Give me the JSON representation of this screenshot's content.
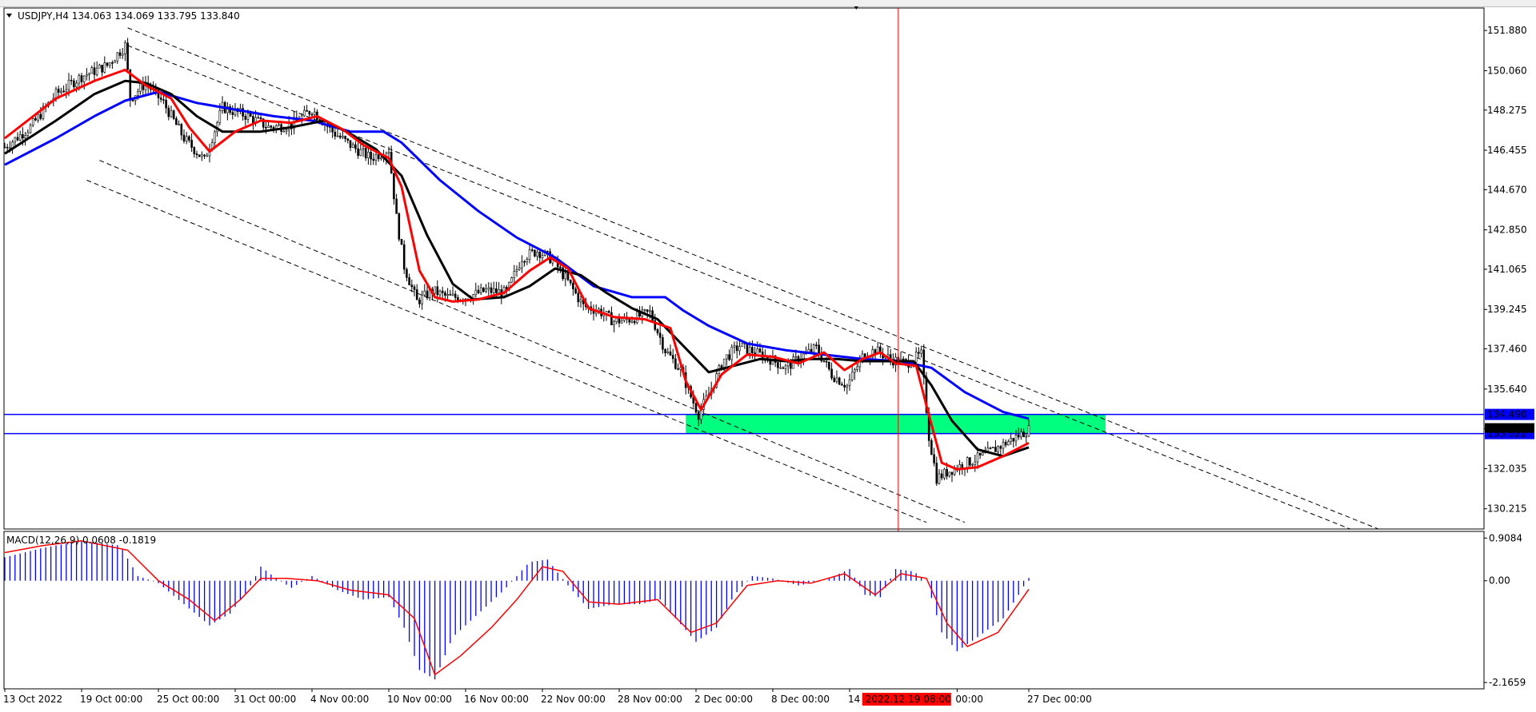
{
  "chart_data": [
    {
      "type": "candlestick",
      "title": "USDJPY,H4  134.063 134.069 133.795 133.840",
      "symbol": "USDJPY",
      "timeframe": "H4",
      "ohlc_last": {
        "open": 134.063,
        "high": 134.069,
        "low": 133.795,
        "close": 133.84
      },
      "ylim": [
        129.3,
        152.9
      ],
      "y_ticks": [
        151.88,
        150.06,
        148.275,
        146.455,
        144.67,
        142.85,
        141.065,
        139.245,
        137.46,
        135.64,
        133.84,
        132.035,
        130.215
      ],
      "x_ticks": [
        "13 Oct 2022",
        "19 Oct 00:00",
        "25 Oct 00:00",
        "31 Oct 00:00",
        "4 Nov 00:00",
        "10 Nov 00:00",
        "16 Nov 00:00",
        "22 Nov 00:00",
        "28 Nov 00:00",
        "2 Dec 00:00",
        "8 Dec 00:00",
        "14 D",
        "00:00",
        "27 Dec 00:00"
      ],
      "x_tick_index": [
        0,
        30,
        60,
        90,
        120,
        150,
        180,
        210,
        240,
        270,
        300,
        330,
        372,
        400
      ],
      "crosshair_label": "2022.12.19 08:00",
      "crosshair_index": 349,
      "horizontal_levels": [
        {
          "value": 134.49,
          "label": "134.490",
          "color": "#0000ff"
        },
        {
          "value": 133.622,
          "label": "133.622",
          "color": "#0000ff"
        }
      ],
      "current_price_label": "133.840",
      "support_zone": {
        "from_index": 266,
        "to_index": 430,
        "low": 133.622,
        "high": 134.49,
        "color": "#00ff7f"
      },
      "channel_lines": [
        {
          "from": [
            48,
            152.0
          ],
          "to": [
            543,
            129.0
          ]
        },
        {
          "from": [
            48,
            151.2
          ],
          "to": [
            543,
            128.5
          ]
        },
        {
          "from": [
            32,
            145.1
          ],
          "to": [
            360,
            129.6
          ]
        },
        {
          "from": [
            37,
            146.0
          ],
          "to": [
            375,
            129.6
          ]
        }
      ],
      "close_points": [
        [
          0,
          146.6
        ],
        [
          10,
          147.5
        ],
        [
          20,
          149.0
        ],
        [
          30,
          149.8
        ],
        [
          40,
          150.3
        ],
        [
          47,
          151.2
        ],
        [
          49,
          148.8
        ],
        [
          55,
          149.5
        ],
        [
          62,
          148.6
        ],
        [
          70,
          147.0
        ],
        [
          78,
          146.0
        ],
        [
          85,
          148.4
        ],
        [
          95,
          148.0
        ],
        [
          103,
          147.5
        ],
        [
          112,
          147.6
        ],
        [
          120,
          148.3
        ],
        [
          128,
          147.3
        ],
        [
          136,
          146.6
        ],
        [
          143,
          146.1
        ],
        [
          150,
          146.5
        ],
        [
          153,
          143.4
        ],
        [
          156,
          141.2
        ],
        [
          161,
          139.6
        ],
        [
          167,
          140.1
        ],
        [
          173,
          139.8
        ],
        [
          180,
          139.8
        ],
        [
          188,
          140.1
        ],
        [
          196,
          140.0
        ],
        [
          202,
          141.6
        ],
        [
          208,
          141.9
        ],
        [
          214,
          141.5
        ],
        [
          220,
          140.5
        ],
        [
          226,
          139.4
        ],
        [
          232,
          139.2
        ],
        [
          238,
          138.7
        ],
        [
          244,
          138.8
        ],
        [
          252,
          139.1
        ],
        [
          258,
          137.4
        ],
        [
          264,
          136.5
        ],
        [
          268,
          135.3
        ],
        [
          271,
          134.5
        ],
        [
          275,
          135.4
        ],
        [
          281,
          137.0
        ],
        [
          287,
          137.6
        ],
        [
          293,
          137.3
        ],
        [
          299,
          137.0
        ],
        [
          305,
          136.6
        ],
        [
          311,
          137.1
        ],
        [
          317,
          137.5
        ],
        [
          323,
          136.3
        ],
        [
          329,
          135.8
        ],
        [
          335,
          137.1
        ],
        [
          340,
          137.4
        ],
        [
          346,
          137.0
        ],
        [
          352,
          136.8
        ],
        [
          358,
          137.2
        ],
        [
          361,
          133.5
        ],
        [
          364,
          131.6
        ],
        [
          370,
          132.0
        ],
        [
          376,
          132.3
        ],
        [
          382,
          132.6
        ],
        [
          388,
          133.0
        ],
        [
          394,
          133.4
        ],
        [
          400,
          133.8
        ]
      ],
      "ma_red": [
        [
          0,
          147.0
        ],
        [
          20,
          148.8
        ],
        [
          35,
          149.6
        ],
        [
          47,
          150.1
        ],
        [
          55,
          149.4
        ],
        [
          65,
          148.8
        ],
        [
          72,
          147.5
        ],
        [
          80,
          146.4
        ],
        [
          90,
          147.3
        ],
        [
          100,
          147.8
        ],
        [
          112,
          147.7
        ],
        [
          122,
          148.0
        ],
        [
          132,
          147.4
        ],
        [
          140,
          146.7
        ],
        [
          150,
          146.1
        ],
        [
          155,
          144.8
        ],
        [
          162,
          141.0
        ],
        [
          168,
          139.8
        ],
        [
          175,
          139.6
        ],
        [
          185,
          139.7
        ],
        [
          195,
          140.0
        ],
        [
          205,
          141.0
        ],
        [
          213,
          141.6
        ],
        [
          220,
          141.1
        ],
        [
          228,
          139.3
        ],
        [
          238,
          138.9
        ],
        [
          250,
          138.8
        ],
        [
          260,
          138.4
        ],
        [
          266,
          136.0
        ],
        [
          272,
          134.7
        ],
        [
          280,
          136.3
        ],
        [
          290,
          137.2
        ],
        [
          300,
          137.1
        ],
        [
          310,
          136.8
        ],
        [
          320,
          137.3
        ],
        [
          328,
          136.5
        ],
        [
          335,
          137.0
        ],
        [
          342,
          137.3
        ],
        [
          348,
          136.8
        ],
        [
          356,
          136.7
        ],
        [
          360,
          134.9
        ],
        [
          366,
          132.3
        ],
        [
          372,
          132.0
        ],
        [
          380,
          132.1
        ],
        [
          390,
          132.6
        ],
        [
          400,
          133.2
        ]
      ],
      "ma_black": [
        [
          0,
          146.3
        ],
        [
          20,
          147.8
        ],
        [
          35,
          149.0
        ],
        [
          47,
          149.6
        ],
        [
          55,
          149.5
        ],
        [
          65,
          149.0
        ],
        [
          75,
          148.0
        ],
        [
          85,
          147.3
        ],
        [
          100,
          147.3
        ],
        [
          112,
          147.5
        ],
        [
          125,
          147.8
        ],
        [
          135,
          147.2
        ],
        [
          145,
          146.5
        ],
        [
          155,
          145.3
        ],
        [
          165,
          142.6
        ],
        [
          175,
          140.4
        ],
        [
          183,
          139.7
        ],
        [
          195,
          139.8
        ],
        [
          205,
          140.3
        ],
        [
          215,
          141.1
        ],
        [
          225,
          140.8
        ],
        [
          235,
          140.0
        ],
        [
          245,
          139.3
        ],
        [
          255,
          138.8
        ],
        [
          265,
          137.6
        ],
        [
          275,
          136.4
        ],
        [
          285,
          136.7
        ],
        [
          295,
          137.0
        ],
        [
          305,
          136.9
        ],
        [
          315,
          137.0
        ],
        [
          325,
          137.0
        ],
        [
          335,
          136.9
        ],
        [
          345,
          136.9
        ],
        [
          355,
          136.9
        ],
        [
          362,
          135.8
        ],
        [
          370,
          134.2
        ],
        [
          380,
          132.9
        ],
        [
          390,
          132.6
        ],
        [
          400,
          133.0
        ]
      ],
      "ma_blue": [
        [
          0,
          145.8
        ],
        [
          20,
          147.0
        ],
        [
          35,
          148.0
        ],
        [
          47,
          148.7
        ],
        [
          60,
          149.1
        ],
        [
          75,
          148.6
        ],
        [
          90,
          148.3
        ],
        [
          105,
          148.0
        ],
        [
          120,
          147.8
        ],
        [
          135,
          147.3
        ],
        [
          148,
          147.3
        ],
        [
          155,
          146.8
        ],
        [
          170,
          145.1
        ],
        [
          185,
          143.7
        ],
        [
          200,
          142.5
        ],
        [
          215,
          141.6
        ],
        [
          230,
          140.3
        ],
        [
          245,
          139.8
        ],
        [
          258,
          139.8
        ],
        [
          265,
          139.2
        ],
        [
          275,
          138.5
        ],
        [
          290,
          137.7
        ],
        [
          305,
          137.4
        ],
        [
          320,
          137.2
        ],
        [
          335,
          137.0
        ],
        [
          350,
          136.9
        ],
        [
          362,
          136.6
        ],
        [
          375,
          135.5
        ],
        [
          390,
          134.6
        ],
        [
          400,
          134.3
        ]
      ]
    },
    {
      "type": "bar",
      "title": "MACD(12,26,9) 0.0608 -0.1819",
      "ylim": [
        -2.3,
        1.05
      ],
      "y_ticks": [
        0.9084,
        0.0,
        -2.1659
      ],
      "y_tick_labels": [
        "0.9084",
        "0.00",
        "-2.1659"
      ],
      "hist_points": [
        [
          0,
          0.5
        ],
        [
          15,
          0.7
        ],
        [
          30,
          0.85
        ],
        [
          45,
          0.75
        ],
        [
          52,
          0.1
        ],
        [
          60,
          -0.05
        ],
        [
          70,
          -0.5
        ],
        [
          80,
          -0.95
        ],
        [
          88,
          -0.7
        ],
        [
          95,
          -0.2
        ],
        [
          100,
          0.3
        ],
        [
          106,
          0.05
        ],
        [
          112,
          -0.15
        ],
        [
          120,
          0.1
        ],
        [
          130,
          -0.2
        ],
        [
          140,
          -0.4
        ],
        [
          150,
          -0.35
        ],
        [
          156,
          -1.0
        ],
        [
          162,
          -1.9
        ],
        [
          168,
          -2.1
        ],
        [
          175,
          -1.2
        ],
        [
          185,
          -0.7
        ],
        [
          195,
          -0.2
        ],
        [
          205,
          0.4
        ],
        [
          212,
          0.45
        ],
        [
          220,
          -0.1
        ],
        [
          228,
          -0.6
        ],
        [
          238,
          -0.5
        ],
        [
          248,
          -0.5
        ],
        [
          256,
          -0.4
        ],
        [
          262,
          -0.8
        ],
        [
          270,
          -1.3
        ],
        [
          278,
          -1.0
        ],
        [
          285,
          -0.3
        ],
        [
          292,
          0.1
        ],
        [
          300,
          0.05
        ],
        [
          310,
          -0.1
        ],
        [
          320,
          0.0
        ],
        [
          330,
          0.25
        ],
        [
          336,
          -0.3
        ],
        [
          342,
          -0.35
        ],
        [
          348,
          0.25
        ],
        [
          355,
          0.2
        ],
        [
          360,
          0.0
        ],
        [
          366,
          -1.1
        ],
        [
          372,
          -1.5
        ],
        [
          380,
          -1.2
        ],
        [
          390,
          -0.8
        ],
        [
          396,
          -0.3
        ],
        [
          400,
          0.0608
        ]
      ],
      "signal_points": [
        [
          0,
          0.6
        ],
        [
          15,
          0.75
        ],
        [
          30,
          0.85
        ],
        [
          48,
          0.65
        ],
        [
          60,
          0.0
        ],
        [
          72,
          -0.4
        ],
        [
          82,
          -0.85
        ],
        [
          92,
          -0.4
        ],
        [
          100,
          0.05
        ],
        [
          110,
          0.05
        ],
        [
          122,
          0.0
        ],
        [
          135,
          -0.2
        ],
        [
          150,
          -0.3
        ],
        [
          160,
          -0.8
        ],
        [
          168,
          -2.0
        ],
        [
          178,
          -1.6
        ],
        [
          190,
          -1.0
        ],
        [
          200,
          -0.4
        ],
        [
          210,
          0.3
        ],
        [
          218,
          0.2
        ],
        [
          228,
          -0.45
        ],
        [
          240,
          -0.5
        ],
        [
          255,
          -0.4
        ],
        [
          268,
          -1.1
        ],
        [
          278,
          -0.9
        ],
        [
          290,
          -0.1
        ],
        [
          302,
          0.0
        ],
        [
          315,
          -0.05
        ],
        [
          328,
          0.15
        ],
        [
          340,
          -0.3
        ],
        [
          350,
          0.15
        ],
        [
          360,
          0.05
        ],
        [
          368,
          -0.9
        ],
        [
          376,
          -1.4
        ],
        [
          388,
          -1.1
        ],
        [
          400,
          -0.1819
        ]
      ]
    }
  ],
  "colors": {
    "price": "#000000",
    "ma_red": "#ff0000",
    "ma_black": "#000000",
    "ma_blue": "#0000ff",
    "macd_hist": "#0000ff",
    "macd_signal": "#ff0000",
    "crosshair": "#ff0000",
    "zone": "#00ff7f",
    "level": "#0000ff",
    "price_label_bg": "#000000",
    "crosshair_label_bg": "#ff0000"
  }
}
